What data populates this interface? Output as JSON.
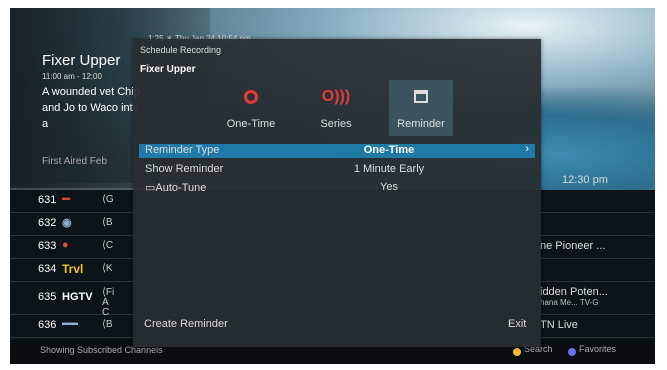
{
  "background": {
    "clock": "1:25 ☀ Thu Jan 24 10:54 pm",
    "show_title": "Fixer Upper",
    "show_time": "11:00 am - 12:00",
    "show_desc": "A wounded vet Chip and Jo to Waco into a",
    "first_aired": "First Aired Feb",
    "right_time": "12:30 pm"
  },
  "guide": {
    "rows": [
      {
        "channel": "631",
        "logo": "",
        "program": "⟨G",
        "right": "",
        "right_sub": ""
      },
      {
        "channel": "632",
        "logo": "",
        "program": "⟨B",
        "right": "",
        "right_sub": ""
      },
      {
        "channel": "633",
        "logo": "",
        "program": "⟨C",
        "right": "ne Pioneer ...",
        "right_sub": ""
      },
      {
        "channel": "634",
        "logo": "Trvl",
        "program": "⟨K",
        "right": "",
        "right_sub": ""
      },
      {
        "channel": "635",
        "logo": "HGTV",
        "program": "⟨Fi A C",
        "right": "idden Poten...",
        "right_sub": "hana Me...  TV-G"
      },
      {
        "channel": "636",
        "logo": "",
        "program": "⟨B",
        "right": "TN Live",
        "right_sub": ""
      }
    ]
  },
  "bottombar": {
    "status": "Showing Subscribed Channels",
    "search": "Search",
    "favorites": "Favorites",
    "search_color": "#f2c12e",
    "favorites_color": "#6f6cf2"
  },
  "modal": {
    "header": "Schedule Recording",
    "program": "Fixer Upper",
    "options": [
      {
        "label": "One-Time",
        "icon": "record-once-icon"
      },
      {
        "label": "Series",
        "icon": "record-series-icon"
      },
      {
        "label": "Reminder",
        "icon": "calendar-icon"
      }
    ],
    "settings": [
      {
        "key": "Reminder Type",
        "value": "One-Time"
      },
      {
        "key": "Show Reminder",
        "value": "1 Minute Early"
      },
      {
        "key": "Auto-Tune",
        "value": "Yes"
      }
    ],
    "create_label": "Create Reminder",
    "exit_label": "Exit"
  }
}
